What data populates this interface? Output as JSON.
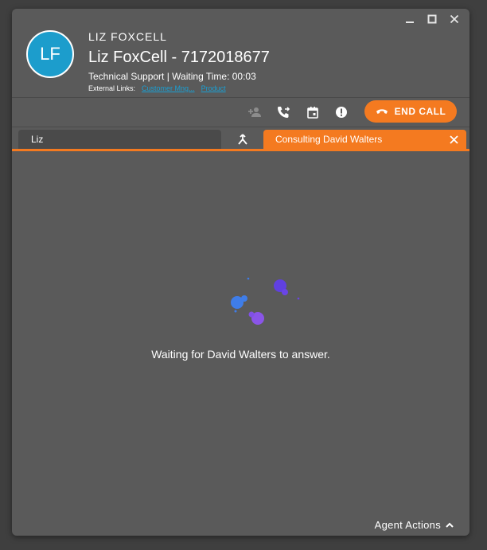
{
  "window": {
    "controls": {
      "minimize_icon": "minimize-icon",
      "maximize_icon": "maximize-icon",
      "close_icon": "close-icon"
    }
  },
  "caller": {
    "initials": "LF",
    "name_caps": "LIZ FOXCELL",
    "title": "Liz FoxCell - 7172018677",
    "meta": "Technical Support | Waiting Time: 00:03",
    "external_links_label": "External Links:",
    "external_links": [
      "Customer Mng...",
      "Product"
    ]
  },
  "toolbar": {
    "end_call_label": "END CALL",
    "icons": [
      "add-participant-icon",
      "transfer-call-icon",
      "calendar-icon",
      "alert-icon",
      "hangup-phone-icon"
    ]
  },
  "tabs": {
    "liz_label": "Liz",
    "consult_label": "Consulting David Walters"
  },
  "content": {
    "waiting_text": "Waiting for David Walters to answer."
  },
  "footer": {
    "agent_actions_label": "Agent Actions"
  },
  "colors": {
    "accent": "#f47a20",
    "avatar": "#1c9dcc",
    "panel": "#5a5a5a",
    "link": "#1a9fd3"
  }
}
